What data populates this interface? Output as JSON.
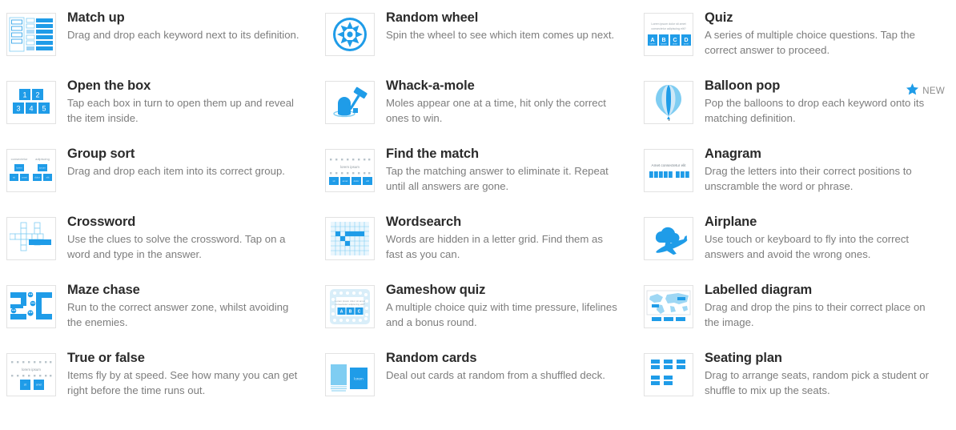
{
  "accent": "#1f9ce8",
  "accent_light": "#7fcdf2",
  "title_color": "#2b2b2b",
  "desc_color": "#7d7d7d",
  "badge": {
    "label": "NEW",
    "icon": "star-icon",
    "color": "#1f9ce8"
  },
  "cards": [
    {
      "id": "match-up",
      "title": "Match up",
      "desc": "Drag and drop each keyword next to its definition.",
      "icon": "match-up-icon",
      "badge": false
    },
    {
      "id": "random-wheel",
      "title": "Random wheel",
      "desc": "Spin the wheel to see which item comes up next.",
      "icon": "random-wheel-icon",
      "badge": false
    },
    {
      "id": "quiz",
      "title": "Quiz",
      "desc": "A series of multiple choice questions. Tap the correct answer to proceed.",
      "icon": "quiz-icon",
      "icon_text": {
        "question": "Lorem ipsum dolor sit amet consectetur adipiscing elit?",
        "options": [
          "A",
          "B",
          "C",
          "D"
        ]
      },
      "badge": false
    },
    {
      "id": "open-the-box",
      "title": "Open the box",
      "desc": "Tap each box in turn to open them up and reveal the item inside.",
      "icon": "open-the-box-icon",
      "icon_text": {
        "boxes": [
          "1",
          "2",
          "3",
          "4",
          "5"
        ]
      },
      "badge": false
    },
    {
      "id": "whack-a-mole",
      "title": "Whack-a-mole",
      "desc": "Moles appear one at a time, hit only the correct ones to win.",
      "icon": "whack-a-mole-icon",
      "badge": false
    },
    {
      "id": "balloon-pop",
      "title": "Balloon pop",
      "desc": "Pop the balloons to drop each keyword onto its matching definition.",
      "icon": "balloon-pop-icon",
      "badge": true
    },
    {
      "id": "group-sort",
      "title": "Group sort",
      "desc": "Drag and drop each item into its correct group.",
      "icon": "group-sort-icon",
      "icon_text": {
        "groups": [
          "consectetur",
          "adipiscing"
        ]
      },
      "badge": false
    },
    {
      "id": "find-the-match",
      "title": "Find the match",
      "desc": "Tap the matching answer to eliminate it. Repeat until all answers are gone.",
      "icon": "find-the-match-icon",
      "icon_text": {
        "label": "lorem ipsum"
      },
      "badge": false
    },
    {
      "id": "anagram",
      "title": "Anagram",
      "desc": "Drag the letters into their correct positions to unscramble the word or phrase.",
      "icon": "anagram-icon",
      "icon_text": {
        "label": "Amet consectetur elit"
      },
      "badge": false
    },
    {
      "id": "crossword",
      "title": "Crossword",
      "desc": "Use the clues to solve the crossword. Tap on a word and type in the answer.",
      "icon": "crossword-icon",
      "badge": false
    },
    {
      "id": "wordsearch",
      "title": "Wordsearch",
      "desc": "Words are hidden in a letter grid. Find them as fast as you can.",
      "icon": "wordsearch-icon",
      "badge": false
    },
    {
      "id": "airplane",
      "title": "Airplane",
      "desc": "Use touch or keyboard to fly into the correct answers and avoid the wrong ones.",
      "icon": "airplane-icon",
      "badge": false
    },
    {
      "id": "maze-chase",
      "title": "Maze chase",
      "desc": "Run to the correct answer zone, whilst avoiding the enemies.",
      "icon": "maze-chase-icon",
      "badge": false
    },
    {
      "id": "gameshow-quiz",
      "title": "Gameshow quiz",
      "desc": "A multiple choice quiz with time pressure, lifelines and a bonus round.",
      "icon": "gameshow-quiz-icon",
      "icon_text": {
        "question": "Lorem ipsum dolor sit amet consectetur adipiscing elit?",
        "options": [
          "A",
          "B",
          "C"
        ]
      },
      "badge": false
    },
    {
      "id": "labelled-diagram",
      "title": "Labelled diagram",
      "desc": "Drag and drop the pins to their correct place on the image.",
      "icon": "labelled-diagram-icon",
      "badge": false
    },
    {
      "id": "true-or-false",
      "title": "True or false",
      "desc": "Items fly by at speed. See how many you can get right before the time runs out.",
      "icon": "true-or-false-icon",
      "icon_text": {
        "label": "lorem ipsum"
      },
      "badge": false
    },
    {
      "id": "random-cards",
      "title": "Random cards",
      "desc": "Deal out cards at random from a shuffled deck.",
      "icon": "random-cards-icon",
      "icon_text": {
        "label": "lorem"
      },
      "badge": false
    },
    {
      "id": "seating-plan",
      "title": "Seating plan",
      "desc": "Drag to arrange seats, random pick a student or shuffle to mix up the seats.",
      "icon": "seating-plan-icon",
      "badge": false
    }
  ]
}
